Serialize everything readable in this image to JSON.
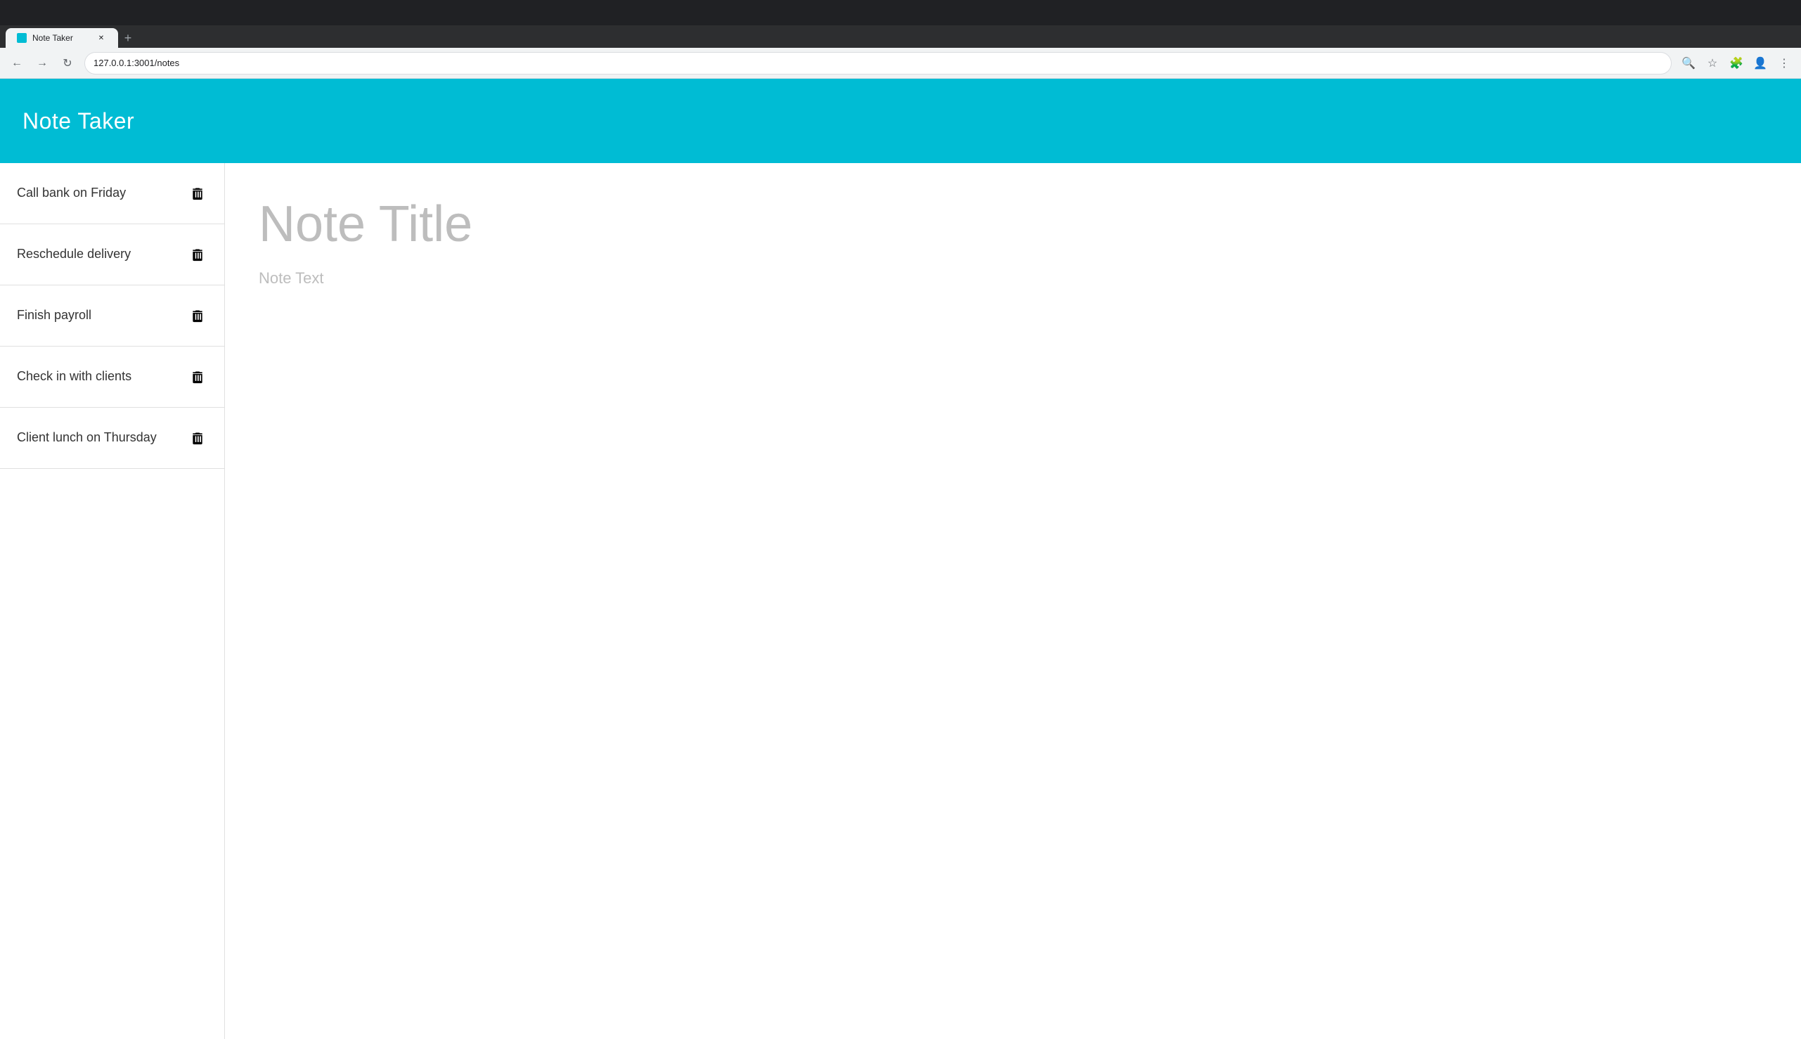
{
  "browser": {
    "tab_title": "Note Taker",
    "url": "127.0.0.1:3001/notes",
    "new_tab_label": "+",
    "back_label": "←",
    "forward_label": "→",
    "reload_label": "↻"
  },
  "app": {
    "title": "Note Taker",
    "header_color": "#00bcd4"
  },
  "notes": [
    {
      "id": "note-1",
      "title": "Call bank on Friday"
    },
    {
      "id": "note-2",
      "title": "Reschedule delivery"
    },
    {
      "id": "note-3",
      "title": "Finish payroll"
    },
    {
      "id": "note-4",
      "title": "Check in with clients"
    },
    {
      "id": "note-5",
      "title": "Client lunch on Thursday"
    }
  ],
  "editor": {
    "title_placeholder": "Note Title",
    "text_placeholder": "Note Text"
  },
  "icons": {
    "trash": "trash-icon",
    "back": "◀",
    "forward": "▶",
    "reload": "⟳",
    "close": "✕"
  }
}
